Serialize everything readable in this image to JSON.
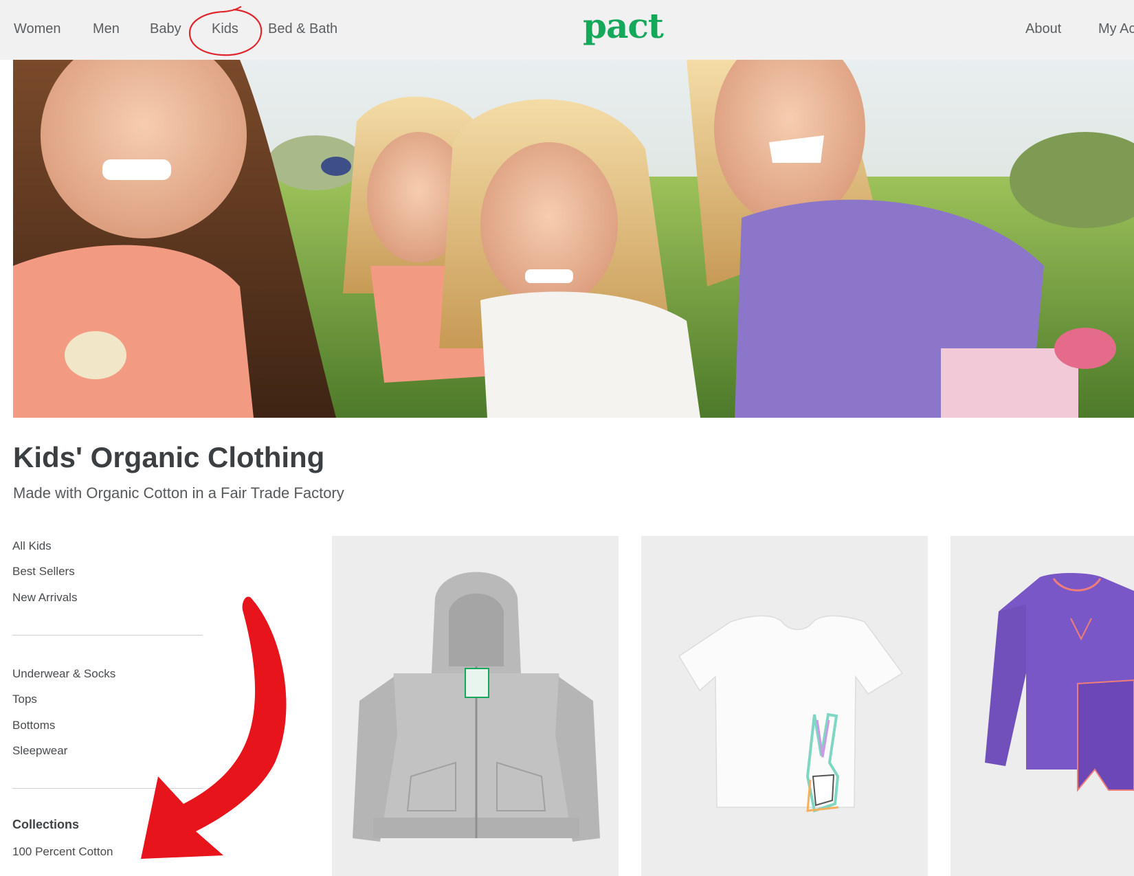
{
  "nav": {
    "left_items": [
      {
        "label": "Women"
      },
      {
        "label": "Men"
      },
      {
        "label": "Baby"
      },
      {
        "label": "Kids"
      },
      {
        "label": "Bed & Bath"
      }
    ],
    "logo": "pact",
    "right_items": [
      {
        "label": "About"
      },
      {
        "label": "My Ac"
      }
    ],
    "active": "Kids"
  },
  "hero": {
    "alt": "hero-photo"
  },
  "page": {
    "title": "Kids' Organic Clothing",
    "subtitle": "Made with Organic Cotton in a Fair Trade Factory"
  },
  "sidebar": {
    "group1": [
      "All Kids",
      "Best Sellers",
      "New Arrivals"
    ],
    "group2": [
      "Underwear & Socks",
      "Tops",
      "Bottoms",
      "Sleepwear"
    ],
    "collections_heading": "Collections",
    "collections": [
      "100 Percent Cotton"
    ]
  },
  "products": [
    {
      "name": "grey-zip-hoodie",
      "color": "#bfbfbf"
    },
    {
      "name": "white-peace-sign-tee",
      "color": "#ffffff"
    },
    {
      "name": "purple-pajama-set",
      "color": "#7a57c6"
    }
  ],
  "colors": {
    "brand_green": "#15a85b",
    "annotation_red": "#e8141b",
    "nav_bg": "#f1f1f1"
  }
}
